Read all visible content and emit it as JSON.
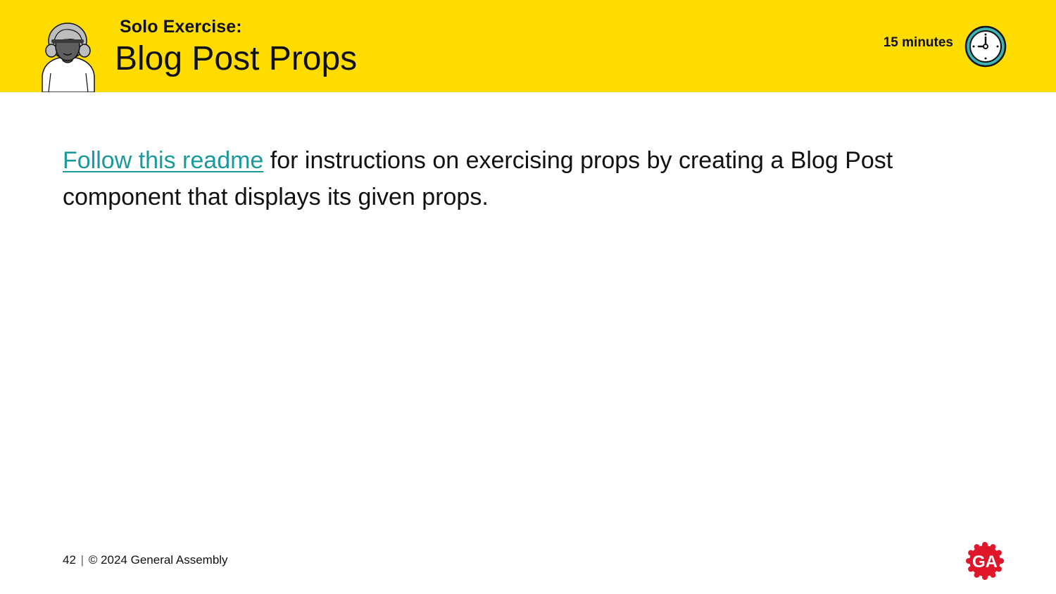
{
  "header": {
    "subtitle": "Solo Exercise:",
    "title": "Blog Post Props",
    "duration": "15 minutes",
    "avatar_icon": "person-avatar-icon",
    "clock_icon": "clock-icon",
    "background_color": "#FFDC00"
  },
  "content": {
    "link_text": "Follow this readme",
    "text": " for instructions on exercising props by creating a Blog Post component that displays its given props.",
    "link_color": "#1A9A9A"
  },
  "footer": {
    "page_number": "42",
    "separator": "|",
    "copyright": "© 2024 General Assembly",
    "logo_text": "GA",
    "logo_color": "#E0162B"
  }
}
